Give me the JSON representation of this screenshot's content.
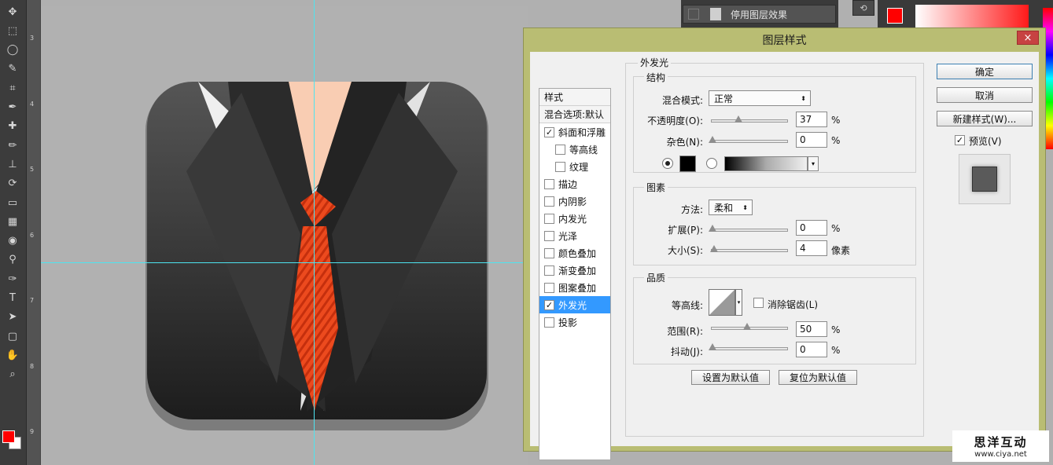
{
  "toolbar": {
    "icons": [
      "move-icon",
      "marquee-icon",
      "lasso-icon",
      "quick-select-icon",
      "crop-icon",
      "eyedropper-icon",
      "healing-icon",
      "brush-icon",
      "stamp-icon",
      "history-brush-icon",
      "eraser-icon",
      "gradient-icon",
      "blur-icon",
      "dodge-icon",
      "pen-icon",
      "type-icon",
      "path-select-icon",
      "shape-icon",
      "hand-icon",
      "zoom-icon"
    ]
  },
  "ruler": {
    "marks": [
      "3",
      "4",
      "5",
      "6",
      "7",
      "8",
      "9"
    ]
  },
  "layers_panel": {
    "row_label": "停用图层效果"
  },
  "dialog": {
    "title": "图层样式",
    "close": "×",
    "styles_header": "样式",
    "blend_options": "混合选项:默认",
    "items": [
      {
        "label": "斜面和浮雕",
        "checked": "✓",
        "indent": false
      },
      {
        "label": "等高线",
        "checked": "",
        "indent": true
      },
      {
        "label": "纹理",
        "checked": "",
        "indent": true
      },
      {
        "label": "描边",
        "checked": "",
        "indent": false
      },
      {
        "label": "内阴影",
        "checked": "",
        "indent": false
      },
      {
        "label": "内发光",
        "checked": "",
        "indent": false
      },
      {
        "label": "光泽",
        "checked": "",
        "indent": false
      },
      {
        "label": "颜色叠加",
        "checked": "",
        "indent": false
      },
      {
        "label": "渐变叠加",
        "checked": "",
        "indent": false
      },
      {
        "label": "图案叠加",
        "checked": "",
        "indent": false
      },
      {
        "label": "外发光",
        "checked": "✓",
        "indent": false,
        "selected": true
      },
      {
        "label": "投影",
        "checked": "",
        "indent": false
      }
    ],
    "outer_glow": {
      "section_title": "外发光",
      "structure": {
        "title": "结构",
        "blend_mode_label": "混合模式:",
        "blend_mode_value": "正常",
        "opacity_label": "不透明度(O):",
        "opacity_value": "37",
        "opacity_unit": "%",
        "opacity_level": 0.37,
        "noise_label": "杂色(N):",
        "noise_value": "0",
        "noise_unit": "%",
        "noise_level": 0,
        "glow_color": "#000000"
      },
      "elements": {
        "title": "图素",
        "technique_label": "方法:",
        "technique_value": "柔和",
        "spread_label": "扩展(P):",
        "spread_value": "0",
        "spread_unit": "%",
        "spread_level": 0,
        "size_label": "大小(S):",
        "size_value": "4",
        "size_unit": "像素",
        "size_level": 0.02
      },
      "quality": {
        "title": "品质",
        "contour_label": "等高线:",
        "anti_alias_label": "消除锯齿(L)",
        "range_label": "范围(R):",
        "range_value": "50",
        "range_unit": "%",
        "range_level": 0.5,
        "jitter_label": "抖动(J):",
        "jitter_value": "0",
        "jitter_unit": "%",
        "jitter_level": 0
      },
      "make_default": "设置为默认值",
      "reset_default": "复位为默认值"
    },
    "buttons": {
      "ok": "确定",
      "cancel": "取消",
      "new_style": "新建样式(W)...",
      "preview_label": "预览(V)",
      "preview_checked": "✓"
    }
  },
  "colors": {
    "accent": "#3399ff",
    "foreground": "#ff0000",
    "background": "#ffffff",
    "dialog_frame": "#b9bd73",
    "guide": "#4de4f0"
  },
  "watermark": {
    "line1": "思洋互动",
    "line2": "www.ciya.net"
  }
}
